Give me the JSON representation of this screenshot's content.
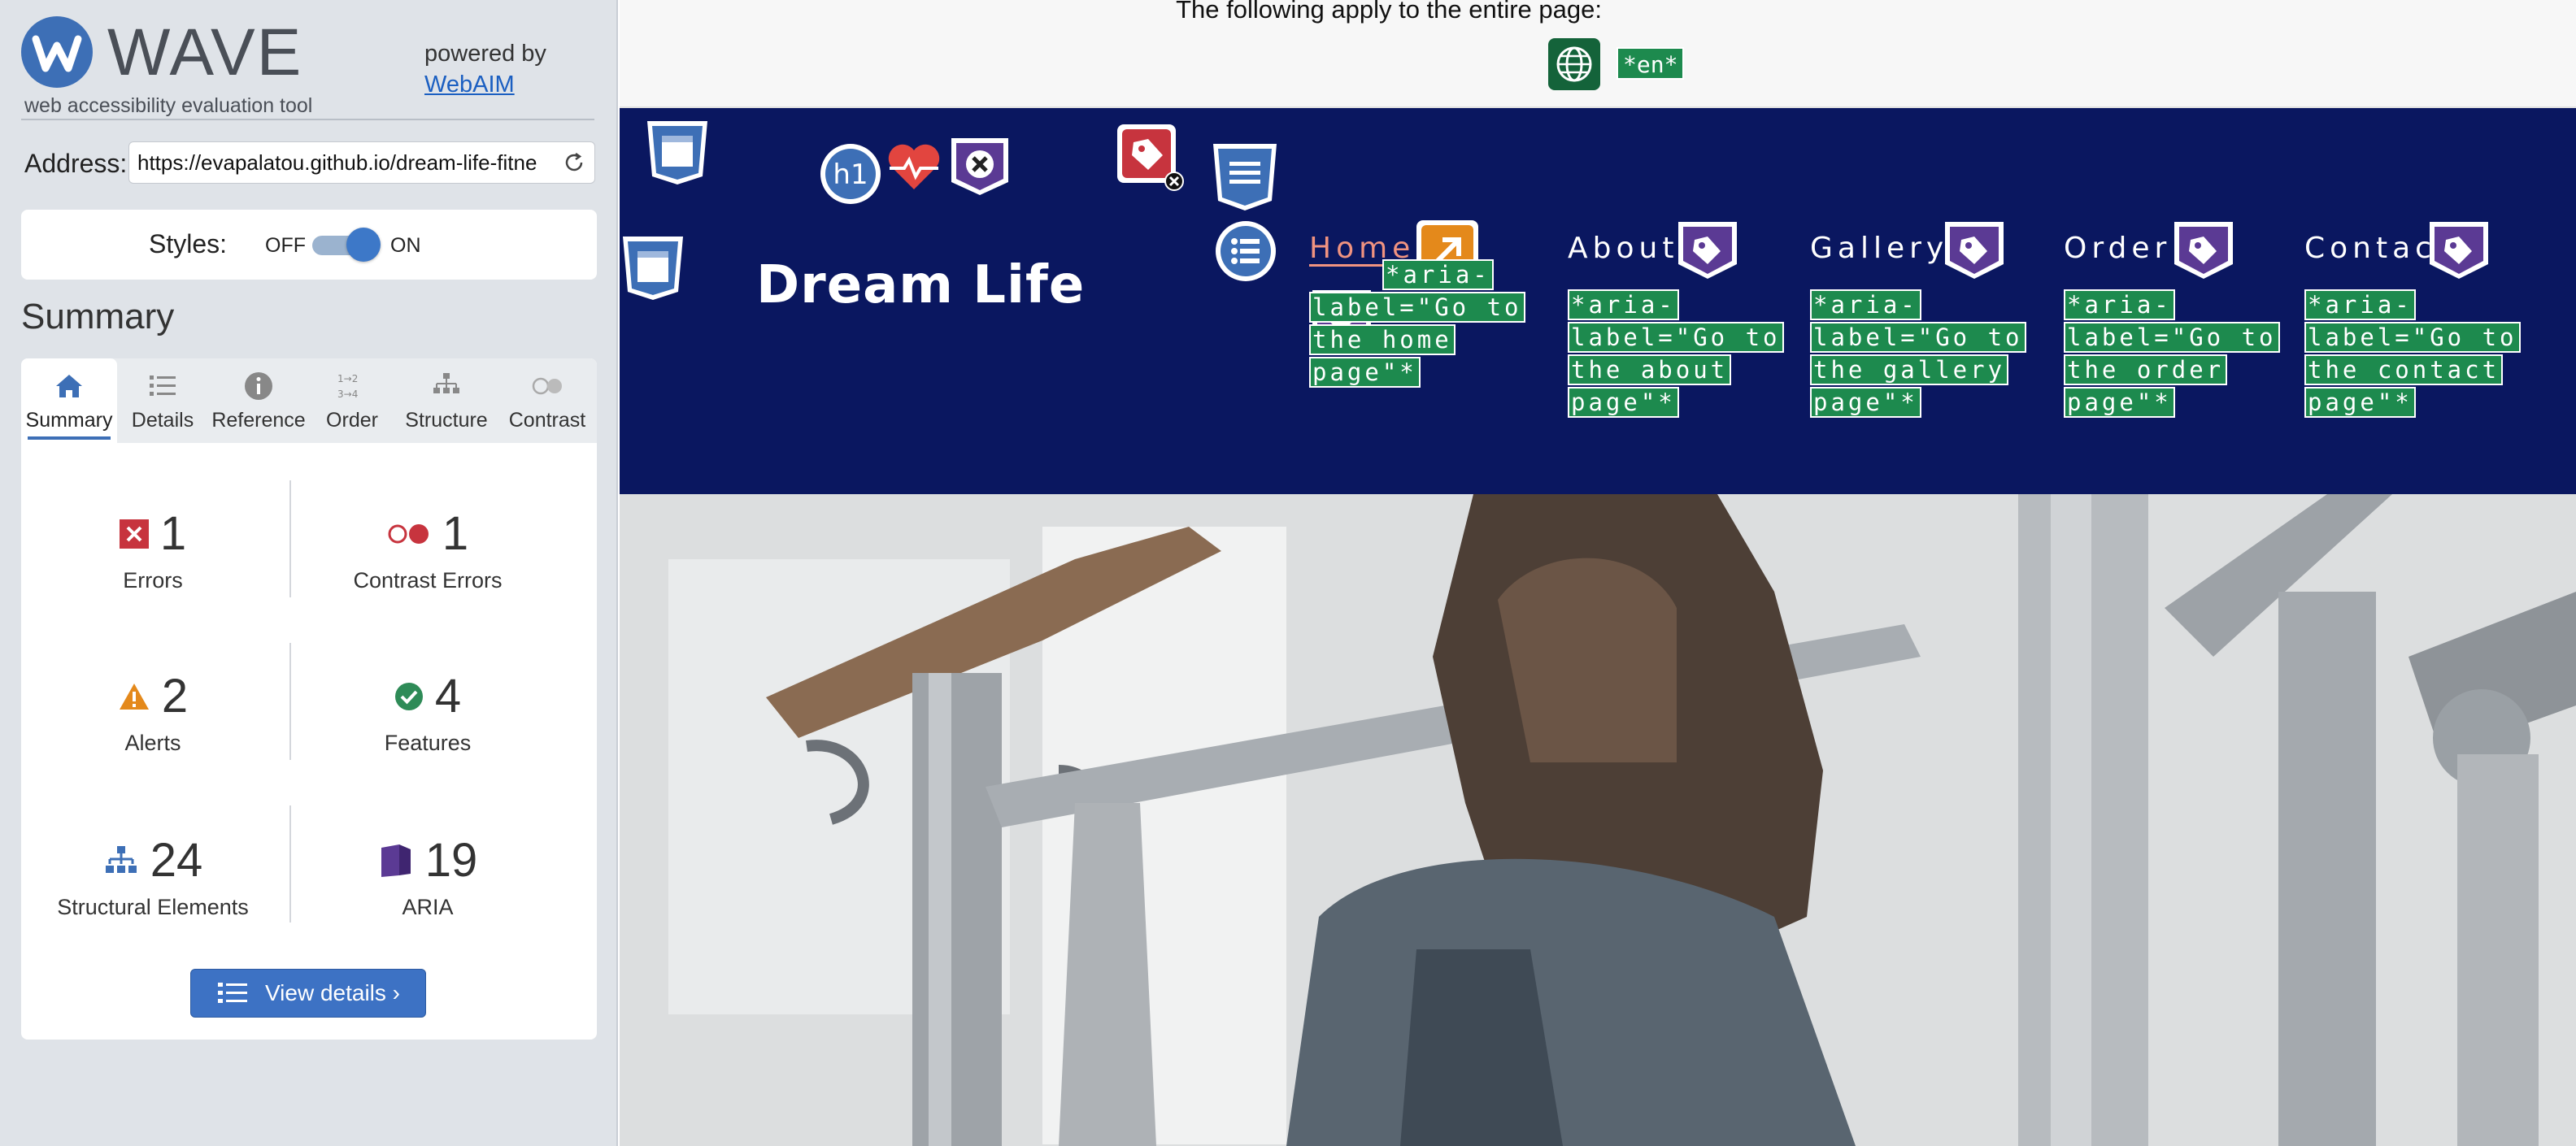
{
  "wave": {
    "brand_name": "WAVE",
    "tagline": "web accessibility evaluation tool",
    "powered_by": "powered by",
    "powered_link": "WebAIM",
    "address_label": "Address:",
    "address_value": "https://evapalatou.github.io/dream-life-fitne",
    "styles_label": "Styles:",
    "styles_off": "OFF",
    "styles_on": "ON",
    "styles_state": "on",
    "summary_title": "Summary",
    "tabs": [
      {
        "label": "Summary",
        "icon": "home-icon",
        "active": true
      },
      {
        "label": "Details",
        "icon": "list-icon",
        "active": false
      },
      {
        "label": "Reference",
        "icon": "info-icon",
        "active": false
      },
      {
        "label": "Order",
        "icon": "order-icon",
        "active": false
      },
      {
        "label": "Structure",
        "icon": "structure-icon",
        "active": false
      },
      {
        "label": "Contrast",
        "icon": "contrast-icon",
        "active": false
      }
    ],
    "stats": {
      "errors": {
        "count": "1",
        "label": "Errors",
        "color": "#c7343e"
      },
      "contrast_errors": {
        "count": "1",
        "label": "Contrast Errors",
        "color": "#c7343e"
      },
      "alerts": {
        "count": "2",
        "label": "Alerts",
        "color": "#e4891b"
      },
      "features": {
        "count": "4",
        "label": "Features",
        "color": "#2e8b57"
      },
      "structural": {
        "count": "24",
        "label": "Structural Elements",
        "color": "#3d6fb6"
      },
      "aria": {
        "count": "19",
        "label": "ARIA",
        "color": "#5b3a94"
      }
    },
    "view_details": "View details ›"
  },
  "preview": {
    "banner_text": "The following apply to the entire page:",
    "lang_tag": "*en*",
    "site_brand": "Dream Life",
    "header_bg": "#0a1760",
    "nav": [
      {
        "label": "Home",
        "aria": "*aria-label=\"Go to the home page\"*",
        "current": true
      },
      {
        "label": "About",
        "aria": "*aria-label=\"Go to the about page\"*",
        "current": false
      },
      {
        "label": "Gallery",
        "aria": "*aria-label=\"Go to the gallery page\"*",
        "current": false
      },
      {
        "label": "Order",
        "aria": "*aria-label=\"Go to the order page\"*",
        "current": false
      },
      {
        "label": "Contact",
        "aria": "*aria-label=\"Go to the contact page\"*",
        "current": false
      }
    ],
    "heading_badge": "h1"
  }
}
